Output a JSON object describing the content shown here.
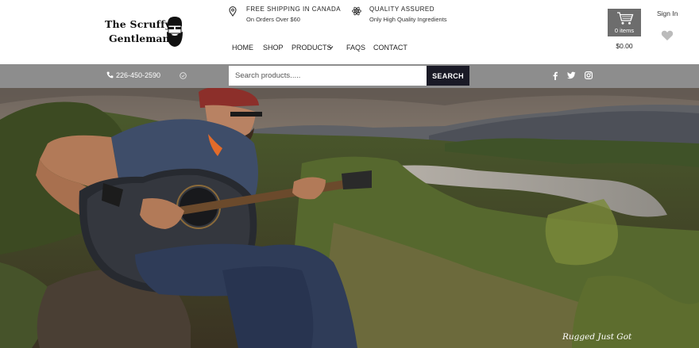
{
  "logo": {
    "line1": "The Scruffy",
    "line2": "Gentleman",
    "icon": "bearded-man-logo"
  },
  "promos": [
    {
      "icon": "location-pin-icon",
      "title": "FREE SHIPPING IN CANADA",
      "subtitle": "On Orders Over $60"
    },
    {
      "icon": "atom-icon",
      "title": "QUALITY ASSURED",
      "subtitle": "Only High Quality Ingredients"
    }
  ],
  "nav": {
    "items": [
      "HOME",
      "SHOP",
      "PRODUCTS",
      "FAQS",
      "CONTACT"
    ],
    "dropdown_icon": "chevron-down-icon"
  },
  "cart": {
    "count_label": "0 items",
    "total": "$0.00",
    "icon": "shopping-cart-icon"
  },
  "account": {
    "signin": "Sign In",
    "wishlist_icon": "heart-icon"
  },
  "topbar": {
    "phone": "226-450-2590",
    "search_placeholder": "Search products.....",
    "search_button": "SEARCH",
    "social": [
      "facebook-icon",
      "twitter-icon",
      "instagram-icon"
    ]
  },
  "hero": {
    "tagline": "Rugged Just Got"
  },
  "colors": {
    "bar": "#8d8d8d",
    "search_button": "#1a1a26",
    "cart_box": "#6d6d6d"
  }
}
